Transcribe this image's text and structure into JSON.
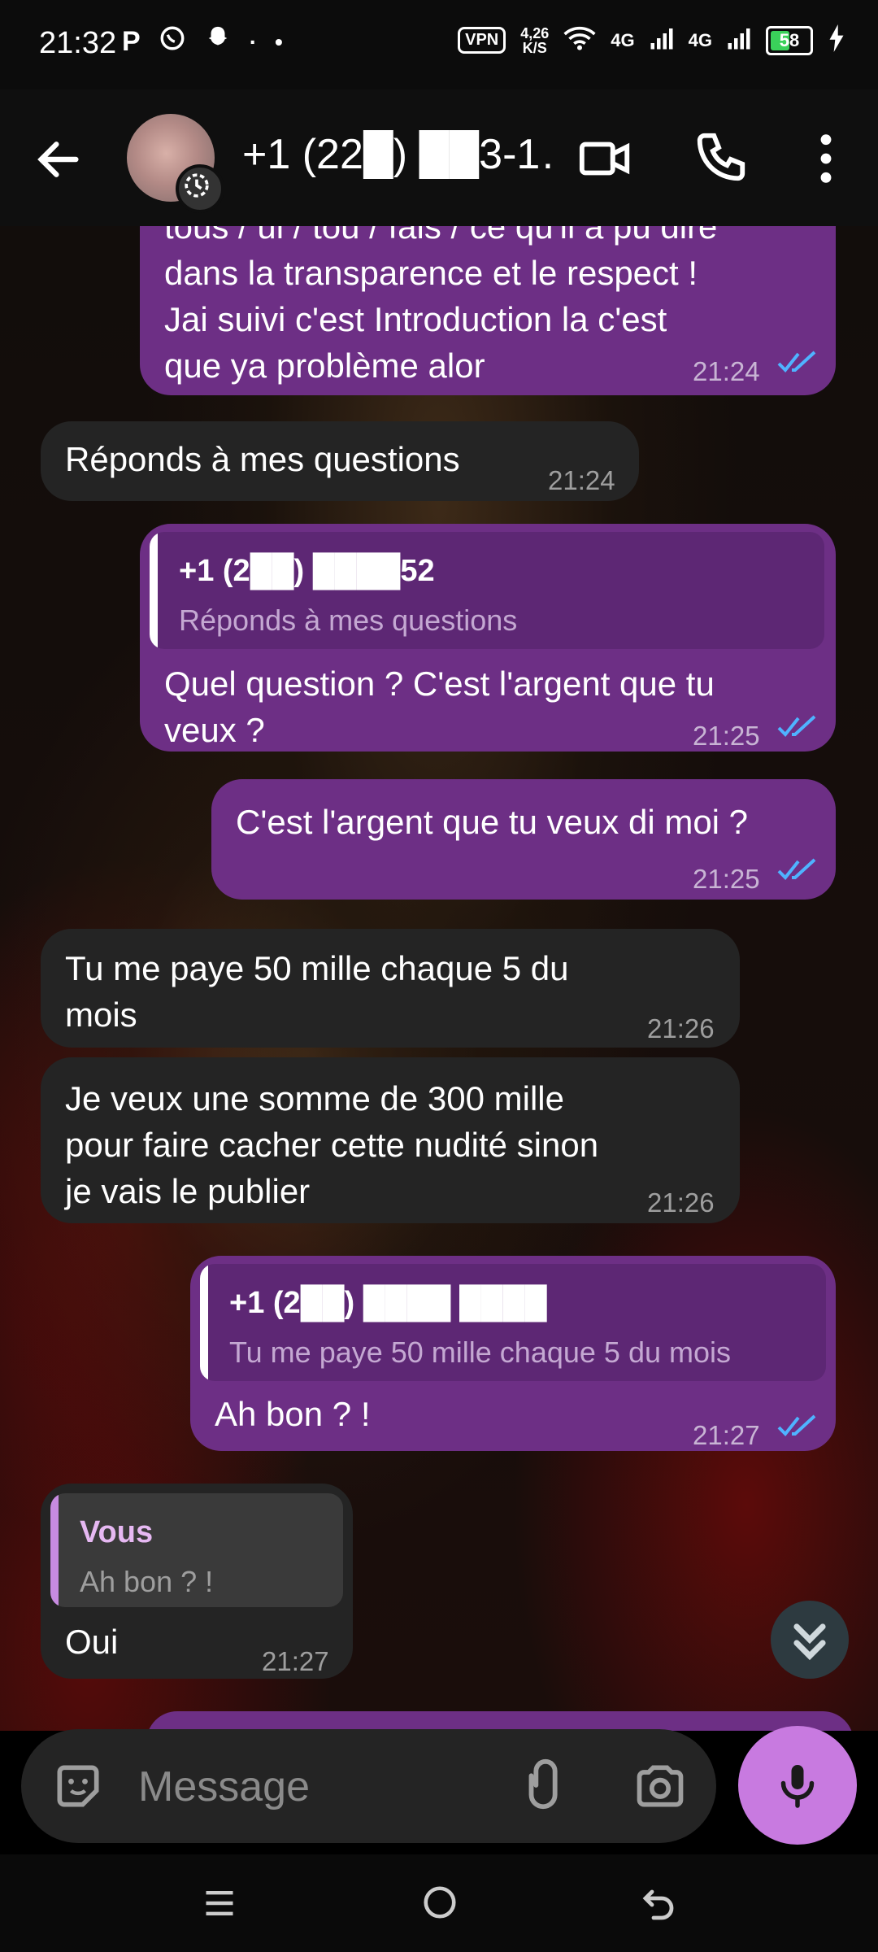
{
  "status_bar": {
    "time": "21:32",
    "icons": [
      "parking-icon",
      "whatsapp-icon",
      "snapchat-icon"
    ],
    "vpn": "VPN",
    "speed_value": "4,26",
    "speed_unit": "K/S",
    "network_1": "4G",
    "network_2": "4G",
    "battery": "58",
    "battery_level": 0.58,
    "battery_color": "#3ad15a"
  },
  "header": {
    "contact_name": "+1 (22█) ██3-1…"
  },
  "messages": [
    {
      "direction": "outgoing",
      "lines": [
        "tous / ui / tou / fais / ce qu'il a pu dire",
        "dans la transparence et le respect !",
        "Jai suivi c'est Introduction la c'est",
        "que ya problème alor"
      ],
      "time": "21:24",
      "status": "read"
    },
    {
      "direction": "incoming",
      "lines": [
        "Réponds à mes questions"
      ],
      "time": "21:24"
    },
    {
      "direction": "outgoing",
      "quote": {
        "name": "+1 (2██) ████52",
        "text": "Réponds à mes questions"
      },
      "lines": [
        "Quel question ? C'est l'argent que tu",
        "veux ?"
      ],
      "time": "21:25",
      "status": "read"
    },
    {
      "direction": "outgoing",
      "lines": [
        "C'est l'argent que tu veux di moi ?"
      ],
      "time": "21:25",
      "status": "read"
    },
    {
      "direction": "incoming",
      "lines": [
        "Tu me paye 50 mille chaque 5 du",
        "mois"
      ],
      "time": "21:26"
    },
    {
      "direction": "incoming",
      "lines": [
        "Je veux une somme de 300 mille",
        "pour faire cacher cette nudité sinon",
        "je vais le publier"
      ],
      "time": "21:26"
    },
    {
      "direction": "outgoing",
      "quote": {
        "name": "+1 (2██) ████ ████",
        "text": "Tu me paye 50 mille chaque 5 du mois"
      },
      "lines": [
        "Ah bon ? !"
      ],
      "time": "21:27",
      "status": "read"
    },
    {
      "direction": "incoming",
      "quote": {
        "name": "Vous",
        "text": "Ah bon ? !"
      },
      "lines": [
        "Oui"
      ],
      "time": "21:27"
    }
  ],
  "composer": {
    "placeholder": "Message"
  },
  "colors": {
    "outgoing_bubble": "#6d2f85",
    "incoming_bubble": "#242424",
    "accent": "#c87ae0",
    "read_ticks": "#4fb3ff"
  }
}
